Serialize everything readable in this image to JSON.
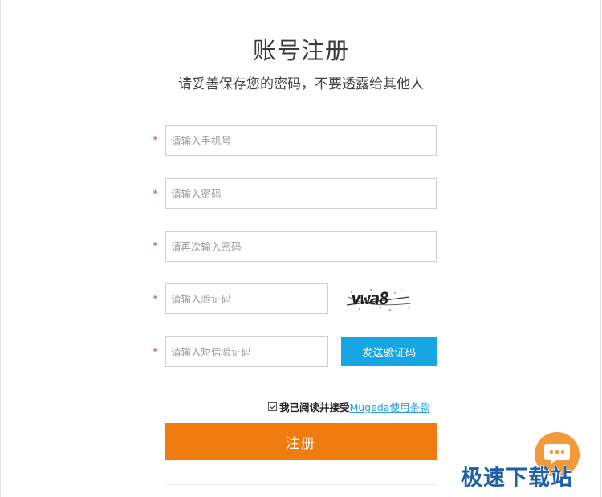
{
  "header": {
    "title": "账号注册",
    "subtitle": "请妥善保存您的密码，不要透露给其他人"
  },
  "form": {
    "required_mark": "*",
    "phone": {
      "value": "",
      "placeholder": "请输入手机号"
    },
    "password": {
      "value": "",
      "placeholder": "请输入密码"
    },
    "password_confirm": {
      "value": "",
      "placeholder": "请再次输入密码"
    },
    "captcha": {
      "value": "",
      "placeholder": "请输入验证码",
      "image_text": "vwa8"
    },
    "sms_code": {
      "value": "",
      "placeholder": "请输入短信验证码"
    },
    "send_sms_label": "发送验证码",
    "agree": {
      "checked": true,
      "text": "我已阅读并接受",
      "link_text": "Mugeda使用条款"
    },
    "submit_label": "注册"
  },
  "widgets": {
    "chat_icon": "chat-bubble-icon",
    "watermark_text": "极速下载站"
  },
  "colors": {
    "primary_orange": "#f07c10",
    "sms_blue": "#15a6e3",
    "link_blue": "#2b9fd8",
    "required_red": "#e54848",
    "chat_orange": "#f29a3a",
    "watermark_blue": "#1d5fa8"
  }
}
